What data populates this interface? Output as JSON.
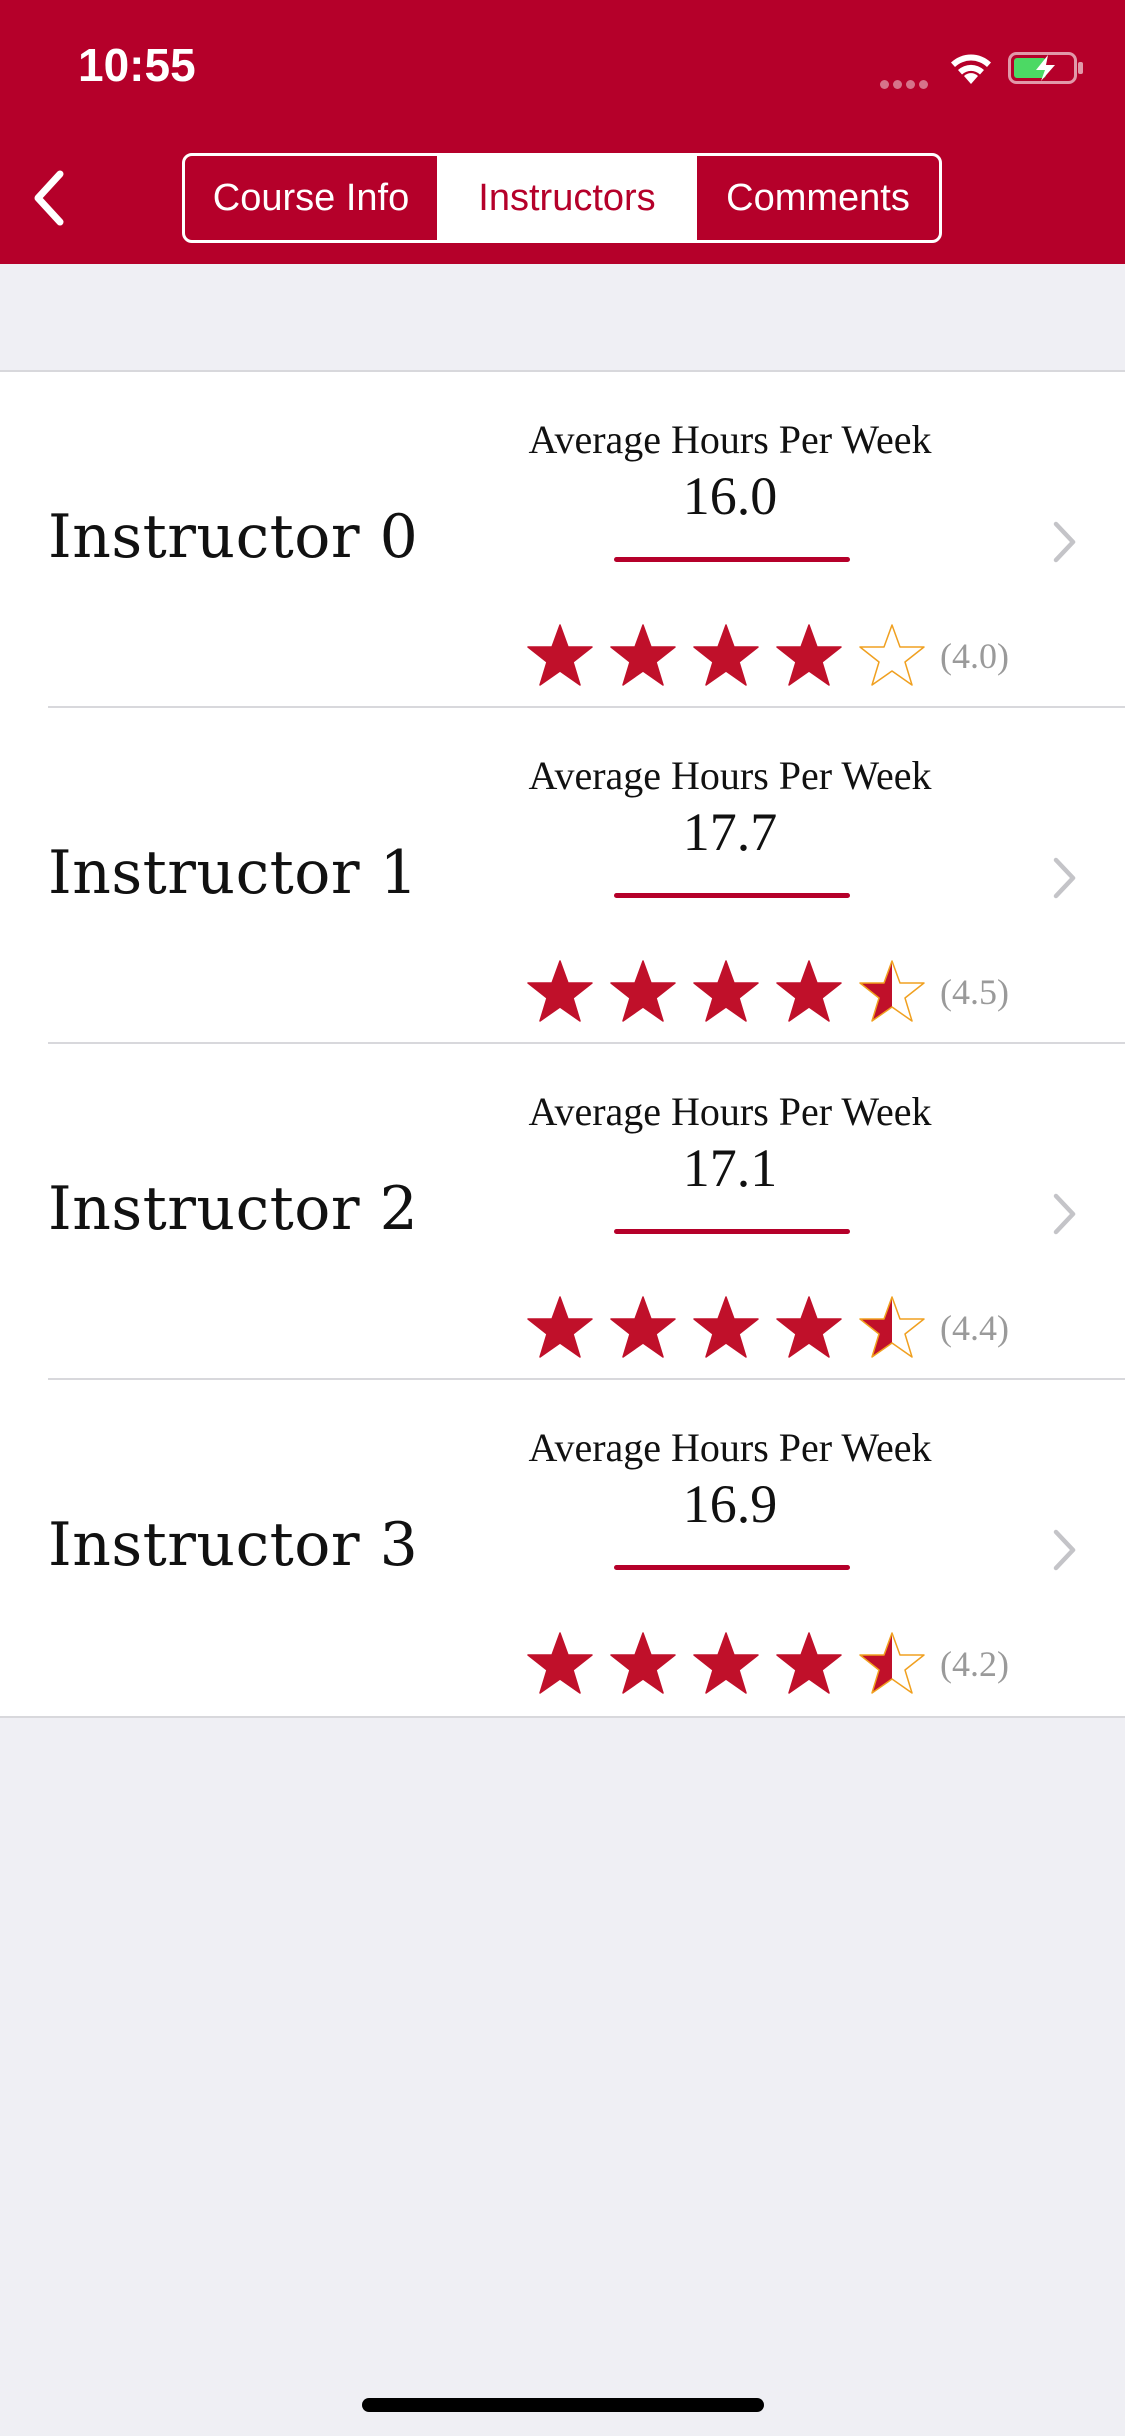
{
  "status_bar": {
    "time": "10:55"
  },
  "colors": {
    "brand": "#b5002a",
    "star_fill": "#c0102a",
    "star_outline": "#f0a020",
    "rating_text": "#9a9a9a"
  },
  "nav": {
    "back_icon": "chevron-left-icon",
    "tabs": [
      {
        "label": "Course Info",
        "selected": false
      },
      {
        "label": "Instructors",
        "selected": true
      },
      {
        "label": "Comments",
        "selected": false
      }
    ]
  },
  "instructors": [
    {
      "name": "Instructor 0",
      "metric_label": "Average Hours Per Week",
      "hours": "16.0",
      "rating": 4.0,
      "rating_text": "(4.0)"
    },
    {
      "name": "Instructor 1",
      "metric_label": "Average Hours Per Week",
      "hours": "17.7",
      "rating": 4.5,
      "rating_text": "(4.5)"
    },
    {
      "name": "Instructor 2",
      "metric_label": "Average Hours Per Week",
      "hours": "17.1",
      "rating": 4.4,
      "rating_text": "(4.4)"
    },
    {
      "name": "Instructor 3",
      "metric_label": "Average Hours Per Week",
      "hours": "16.9",
      "rating": 4.2,
      "rating_text": "(4.2)"
    }
  ]
}
